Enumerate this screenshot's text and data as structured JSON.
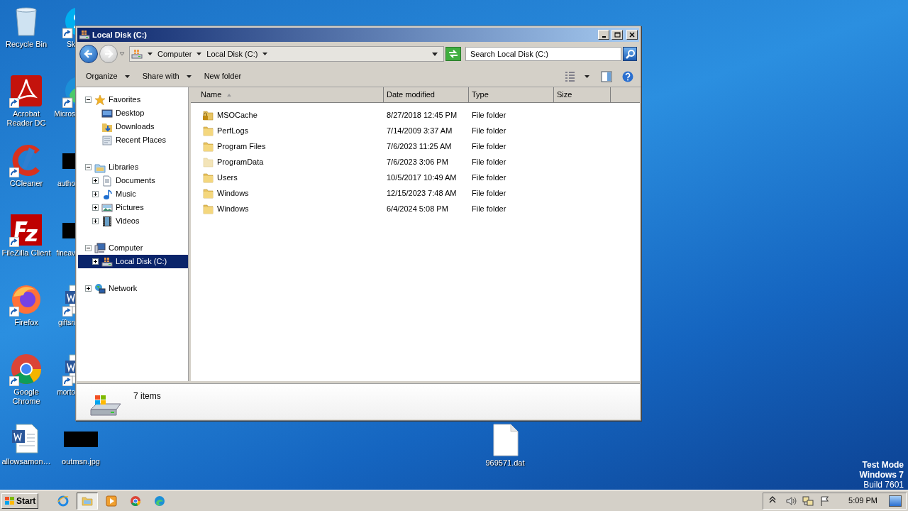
{
  "desktop_icons": [
    {
      "label": "Recycle Bin",
      "kind": "bin",
      "shortcut": false
    },
    {
      "label": "Acrobat Reader DC",
      "kind": "acrobat",
      "shortcut": true
    },
    {
      "label": "CCleaner",
      "kind": "ccleaner",
      "shortcut": true
    },
    {
      "label": "FileZilla Client",
      "kind": "filezilla",
      "shortcut": true
    },
    {
      "label": "Firefox",
      "kind": "firefox",
      "shortcut": true
    },
    {
      "label": "Google Chrome",
      "kind": "chrome",
      "shortcut": true
    },
    {
      "label": "allowsamon…",
      "kind": "word",
      "shortcut": false
    }
  ],
  "desktop_icons_partial": [
    {
      "label": "Sk",
      "kind": "skype",
      "shortcut": true
    },
    {
      "label": "Micros",
      "kind": "edge",
      "shortcut": true
    },
    {
      "label": "autho",
      "kind": "redacted",
      "shortcut": false
    },
    {
      "label": "fineav",
      "kind": "redacted",
      "shortcut": false
    },
    {
      "label": "giftsn",
      "kind": "word",
      "shortcut": true
    },
    {
      "label": "morto",
      "kind": "word",
      "shortcut": true
    }
  ],
  "desktop_files": [
    {
      "label": "outmsn.jpg",
      "kind": "redacted"
    },
    {
      "label": "969571.dat",
      "kind": "blank"
    }
  ],
  "window": {
    "title": "Local Disk (C:)",
    "breadcrumb": [
      "Computer",
      "Local Disk (C:)"
    ],
    "search": {
      "placeholder": "Search Local Disk (C:)"
    },
    "toolbar": [
      {
        "label": "Organize",
        "dropdown": true
      },
      {
        "label": "Share with",
        "dropdown": true
      },
      {
        "label": "New folder",
        "dropdown": false
      }
    ],
    "nav_tree": [
      {
        "label": "Favorites",
        "kind": "star",
        "expanded": true,
        "selected": false,
        "children": [
          {
            "label": "Desktop",
            "kind": "desktop",
            "selected": false
          },
          {
            "label": "Downloads",
            "kind": "downloads",
            "selected": false
          },
          {
            "label": "Recent Places",
            "kind": "recent",
            "selected": false
          }
        ]
      },
      {
        "label": "Libraries",
        "kind": "library",
        "expanded": true,
        "selected": false,
        "children": [
          {
            "label": "Documents",
            "kind": "document",
            "expanded": false,
            "selected": false
          },
          {
            "label": "Music",
            "kind": "music",
            "expanded": false,
            "selected": false
          },
          {
            "label": "Pictures",
            "kind": "pictures",
            "expanded": false,
            "selected": false
          },
          {
            "label": "Videos",
            "kind": "videos",
            "expanded": false,
            "selected": false
          }
        ]
      },
      {
        "label": "Computer",
        "kind": "computer",
        "expanded": true,
        "selected": false,
        "children": [
          {
            "label": "Local Disk (C:)",
            "kind": "drive",
            "expanded": false,
            "selected": true
          }
        ]
      },
      {
        "label": "Network",
        "kind": "network",
        "expanded": false,
        "selected": false
      }
    ],
    "columns": [
      {
        "label": "Name",
        "sorted": true
      },
      {
        "label": "Date modified",
        "sorted": false
      },
      {
        "label": "Type",
        "sorted": false
      },
      {
        "label": "Size",
        "sorted": false
      }
    ],
    "rows": [
      {
        "name": "MSOCache",
        "date_modified": "8/27/2018 12:45 PM",
        "type": "File folder",
        "kind": "locked"
      },
      {
        "name": "PerfLogs",
        "date_modified": "7/14/2009 3:37 AM",
        "type": "File folder",
        "kind": "folder"
      },
      {
        "name": "Program Files",
        "date_modified": "7/6/2023 11:25 AM",
        "type": "File folder",
        "kind": "folder"
      },
      {
        "name": "ProgramData",
        "date_modified": "7/6/2023 3:06 PM",
        "type": "File folder",
        "kind": "hidden"
      },
      {
        "name": "Users",
        "date_modified": "10/5/2017 10:49 AM",
        "type": "File folder",
        "kind": "folder"
      },
      {
        "name": "Windows",
        "date_modified": "12/15/2023 7:48 AM",
        "type": "File folder",
        "kind": "folder"
      },
      {
        "name": "Windows",
        "date_modified": "6/4/2024 5:08 PM",
        "type": "File folder",
        "kind": "folder"
      }
    ],
    "status": "7 items"
  },
  "os_notice": [
    "Test Mode",
    "Windows 7",
    "Build 7601"
  ],
  "taskbar": {
    "start": "Start",
    "quick_launch": [
      {
        "kind": "ie",
        "selected": false
      },
      {
        "kind": "explorer",
        "selected": true
      },
      {
        "kind": "media",
        "selected": false
      },
      {
        "kind": "chrome",
        "selected": false
      },
      {
        "kind": "edge",
        "selected": false
      }
    ],
    "tray_icons": [
      {
        "kind": "chevron"
      },
      {
        "kind": "volume"
      },
      {
        "kind": "network"
      },
      {
        "kind": "flag"
      }
    ],
    "clock": "5:09 PM"
  }
}
